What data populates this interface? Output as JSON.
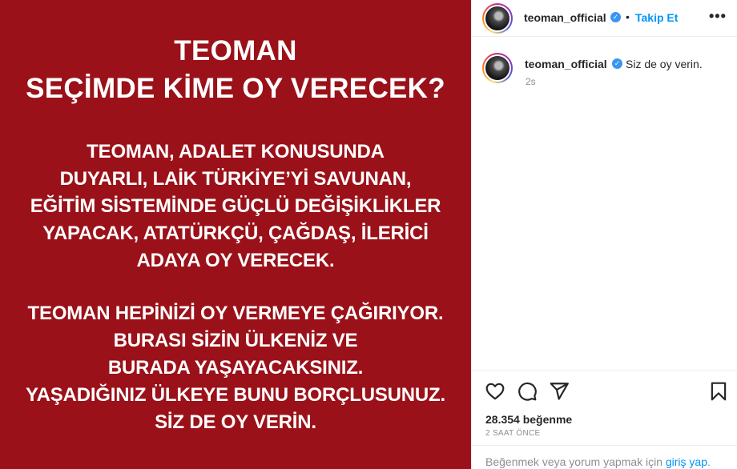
{
  "post_image": {
    "title_lines": [
      "TEOMAN",
      "SEÇİMDE KİME OY VERECEK?"
    ],
    "paragraph1": [
      "TEOMAN, ADALET KONUSUNDA",
      "DUYARLI, LAİK TÜRKİYE’Yİ SAVUNAN,",
      "EĞİTİM SİSTEMİNDE GÜÇLÜ DEĞİŞİKLİKLER",
      "YAPACAK, ATATÜRKÇÜ, ÇAĞDAŞ, İLERİCİ",
      "ADAYA OY VERECEK."
    ],
    "paragraph2": [
      "TEOMAN HEPİNİZİ OY VERMEYE ÇAĞIRIYOR.",
      "BURASI SİZİN ÜLKENİZ VE",
      "BURADA YAŞAYACAKSINIZ.",
      "YAŞADIĞINIZ ÜLKEYE BUNU BORÇLUSUNUZ.",
      "SİZ DE OY VERİN."
    ],
    "background_color": "#9b1119"
  },
  "header": {
    "username": "teoman_official",
    "separator": "•",
    "follow_label": "Takip Et",
    "more_label": "•••"
  },
  "caption": {
    "username": "teoman_official",
    "text": "Siz de oy verin.",
    "time": "2s"
  },
  "actions": {
    "icons": [
      "heart-icon",
      "comment-icon",
      "share-icon",
      "bookmark-icon"
    ]
  },
  "stats": {
    "likes": "28.354 beğenme",
    "posted_ago": "2 SAAT ÖNCE"
  },
  "footer": {
    "prefix": "Beğenmek veya yorum yapmak için ",
    "login_label": "giriş yap",
    "suffix": "."
  },
  "colors": {
    "accent": "#0095f6",
    "verified": "#3897f0",
    "muted": "#8e8e8e"
  }
}
